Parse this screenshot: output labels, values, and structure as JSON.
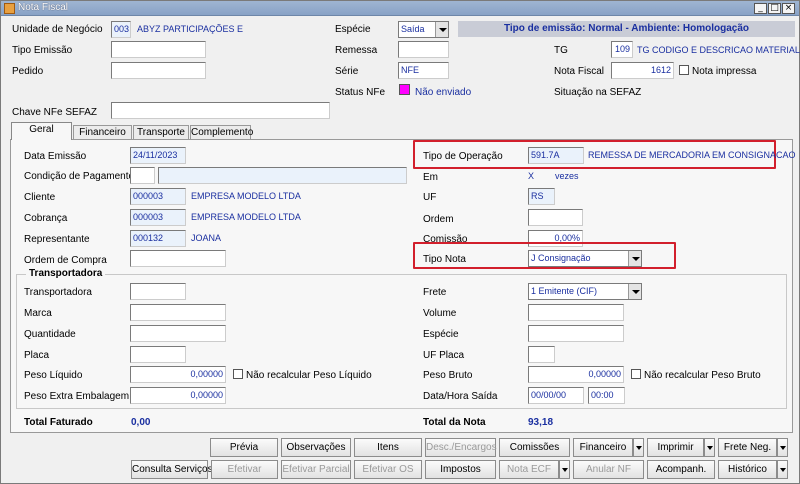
{
  "window": {
    "title": "Nota Fiscal",
    "minimize": "_",
    "maximize": "□",
    "close": "×"
  },
  "header": {
    "unidade_label": "Unidade de Negócio",
    "unidade_code": "003",
    "unidade_name": "ABYZ PARTICIPAÇÕES E",
    "tipo_emissao_label": "Tipo Emissão",
    "tipo_emissao_value": "",
    "pedido_label": "Pedido",
    "pedido_value": "",
    "especie_label": "Espécie",
    "especie_value": "Saída",
    "remessa_label": "Remessa",
    "remessa_value": "",
    "serie_label": "Série",
    "serie_value": "NFE",
    "status_label": "Status NFe",
    "status_value": "Não enviado",
    "status_color": "#ff00ff",
    "banner": "Tipo de emissão: Normal - Ambiente: Homologação",
    "tg_label": "TG",
    "tg_code": "109",
    "tg_name": "TG CODIGO E DESCRICAO MATERIAL",
    "nota_fiscal_label": "Nota Fiscal",
    "nota_fiscal_value": "1612",
    "nota_impressa_label": "Nota impressa",
    "situacao_label": "Situação na SEFAZ",
    "chave_label": "Chave NFe SEFAZ",
    "chave_value": ""
  },
  "tabs": [
    "Geral",
    "Financeiro",
    "Transporte",
    "Complemento"
  ],
  "geral": {
    "data_emissao_label": "Data Emissão",
    "data_emissao_value": "24/11/2023",
    "condicao_label": "Condição de Pagamento",
    "cliente_label": "Cliente",
    "cliente_code": "000003",
    "cliente_name": "EMPRESA MODELO LTDA",
    "cobranca_label": "Cobrança",
    "cobranca_code": "000003",
    "cobranca_name": "EMPRESA MODELO LTDA",
    "representante_label": "Representante",
    "representante_code": "000132",
    "representante_name": "JOANA",
    "ordem_compra_label": "Ordem de Compra",
    "tipo_operacao_label": "Tipo de Operação",
    "tipo_operacao_code": "591.7A",
    "tipo_operacao_name": "REMESSA DE MERCADORIA EM CONSIGNACAO",
    "em_label": "Em",
    "em_x": "X",
    "em_vezes": "vezes",
    "uf_label": "UF",
    "uf_value": "RS",
    "ordem_label": "Ordem",
    "comissao_label": "Comissão",
    "comissao_value": "0,00%",
    "tipo_nota_label": "Tipo Nota",
    "tipo_nota_value": "J Consignação"
  },
  "transportadora": {
    "group_label": "Transportadora",
    "transportadora_label": "Transportadora",
    "marca_label": "Marca",
    "quantidade_label": "Quantidade",
    "placa_label": "Placa",
    "peso_liquido_label": "Peso Líquido",
    "peso_liquido_value": "0,00000",
    "nao_recalc_liq_label": "Não recalcular Peso Líquido",
    "peso_extra_label": "Peso Extra Embalagem",
    "peso_extra_value": "0,00000",
    "frete_label": "Frete",
    "frete_value": "1 Emitente (CIF)",
    "volume_label": "Volume",
    "especie_label": "Espécie",
    "uf_placa_label": "UF Placa",
    "peso_bruto_label": "Peso Bruto",
    "peso_bruto_value": "0,00000",
    "nao_recalc_bruto_label": "Não recalcular Peso Bruto",
    "data_hora_label": "Data/Hora Saída",
    "data_saida_value": "00/00/00",
    "hora_saida_value": "00:00"
  },
  "totals": {
    "total_faturado_label": "Total Faturado",
    "total_faturado_value": "0,00",
    "total_nota_label": "Total da Nota",
    "total_nota_value": "93,18"
  },
  "buttons": {
    "previa": "Prévia",
    "observacoes": "Observações",
    "itens": "Itens",
    "desc_encargos": "Desc./Encargos",
    "comissoes": "Comissões",
    "financeiro": "Financeiro",
    "imprimir": "Imprimir",
    "frete_neg": "Frete Neg.",
    "consulta_servicos": "Consulta Serviços",
    "efetivar": "Efetivar",
    "efetivar_parcial": "Efetivar Parcial",
    "efetivar_os": "Efetivar OS",
    "impostos": "Impostos",
    "nota_ecf": "Nota ECF",
    "anular_nf": "Anular NF",
    "acompanh": "Acompanh.",
    "historico": "Histórico"
  }
}
